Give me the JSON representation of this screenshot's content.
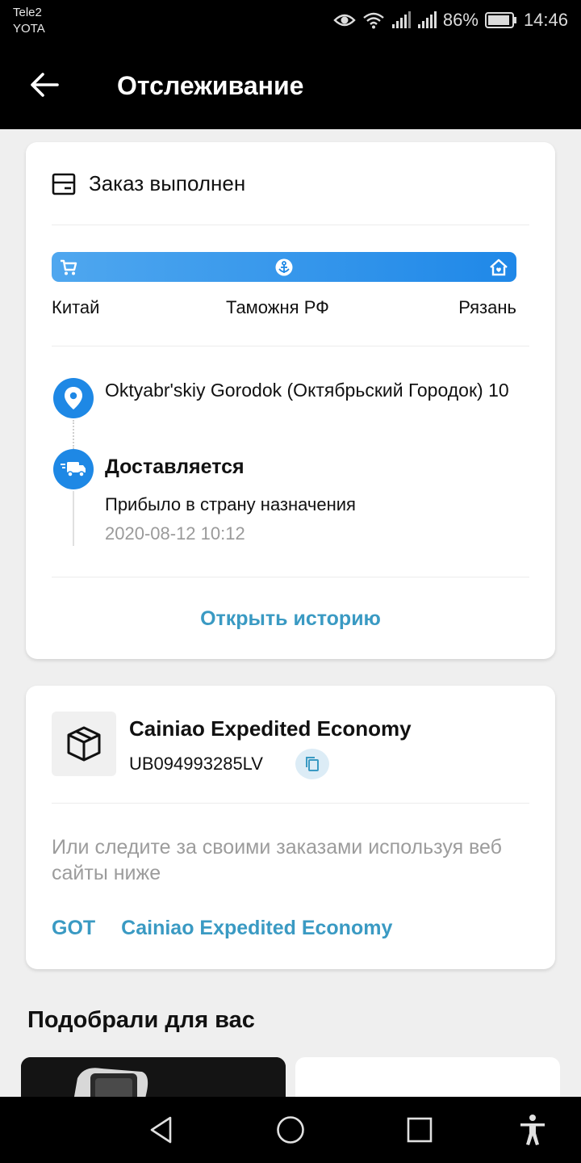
{
  "status_bar": {
    "carrier_line1": "Tele2",
    "carrier_line2": "YOTA",
    "battery": "86%",
    "time": "14:46",
    "icons": [
      "eye-icon",
      "wifi-icon",
      "signal-icon",
      "signal-icon",
      "battery-icon"
    ]
  },
  "header": {
    "title": "Отслеживание",
    "back_icon": "arrow-left-icon"
  },
  "tracking": {
    "status_label": "Заказ выполнен",
    "status_icon": "package-box-icon",
    "progress_icons": [
      "cart-icon",
      "anchor-icon",
      "home-icon"
    ],
    "stages": [
      "Китай",
      "Таможня РФ",
      "Рязань"
    ],
    "address": "Oktyabr'skiy Gorodok (Октябрьский Городок) 10",
    "event": {
      "title": "Доставляется",
      "description": "Прибыло в страну назначения",
      "timestamp": "2020-08-12 10:12"
    },
    "open_history": "Открыть историю"
  },
  "shipment": {
    "carrier": "Cainiao Expedited Economy",
    "tracking_number": "UB094993285LV",
    "hint": "Или следите за своими заказами используя веб сайты ниже",
    "links": [
      "GOT",
      "Cainiao Expedited Economy"
    ]
  },
  "recommendations": {
    "title": "Подобрали для вас"
  },
  "colors": {
    "accent": "#1e88e5",
    "link": "#3a9ac3",
    "background": "#efefef"
  }
}
